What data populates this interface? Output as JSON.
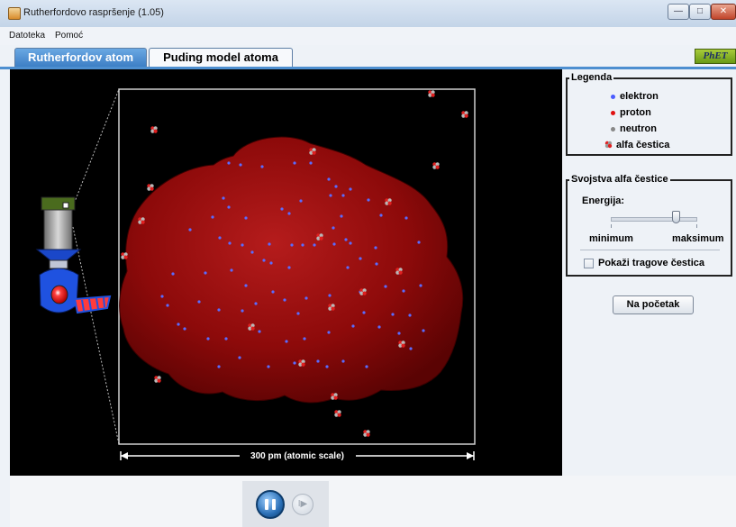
{
  "window": {
    "title": "Rutherfordovo raspršenje (1.05)",
    "minimize_glyph": "—",
    "maximize_glyph": "□",
    "close_glyph": "✕"
  },
  "menu": {
    "file": "Datoteka",
    "help": "Pomoć"
  },
  "tabs": [
    {
      "label": "Rutherfordov atom",
      "selected": false
    },
    {
      "label": "Puding model atoma",
      "selected": true
    }
  ],
  "logo": {
    "text": "PhET"
  },
  "simulation": {
    "scale_label": "300 pm (atomic scale)",
    "colors": {
      "pudding": "#8d0a0a",
      "electron": "#5a6cff",
      "alpha": "#d43a2a"
    }
  },
  "legend": {
    "title": "Legenda",
    "items": [
      {
        "label": "elektron",
        "icon": "electron-dot",
        "color": "#4a5cff"
      },
      {
        "label": "proton",
        "icon": "proton-dot",
        "color": "#e01010"
      },
      {
        "label": "neutron",
        "icon": "neutron-dot",
        "color": "#888888"
      },
      {
        "label": "alfa čestica",
        "icon": "alpha-particle-icon",
        "color": "#d43a2a"
      }
    ]
  },
  "alpha_properties": {
    "title": "Svojstva alfa čestice",
    "energy_label": "Energija:",
    "min_label": "minimum",
    "max_label": "maksimum",
    "energy_value_fraction": 0.75,
    "show_tracks_label": "Pokaži tragove čestica",
    "show_tracks_checked": false
  },
  "reset_button": {
    "label": "Na početak"
  },
  "playback": {
    "pause_icon": "pause-icon",
    "step_icon": "step-icon",
    "step_glyph": "I▶"
  }
}
